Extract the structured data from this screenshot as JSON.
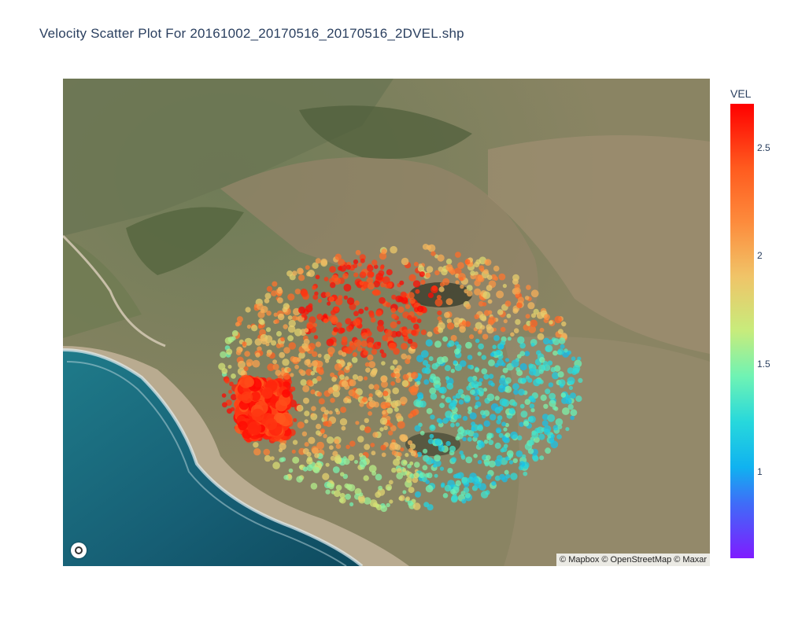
{
  "title": "Velocity Scatter Plot For 20161002_20170516_20170516_2DVEL.shp",
  "map": {
    "basemap": "satellite",
    "attribution": "© Mapbox © OpenStreetMap © Maxar",
    "logo_icon": "mapbox-logo-icon"
  },
  "colorbar": {
    "title": "VEL",
    "colorscale": "rainbow",
    "range": [
      0.55,
      2.72
    ],
    "ticks": [
      "2.5",
      "2",
      "1.5",
      "1"
    ]
  },
  "colors": {
    "title": "#2a3f5f",
    "ocean": "#1e6f80",
    "land": "#8a8463"
  }
}
